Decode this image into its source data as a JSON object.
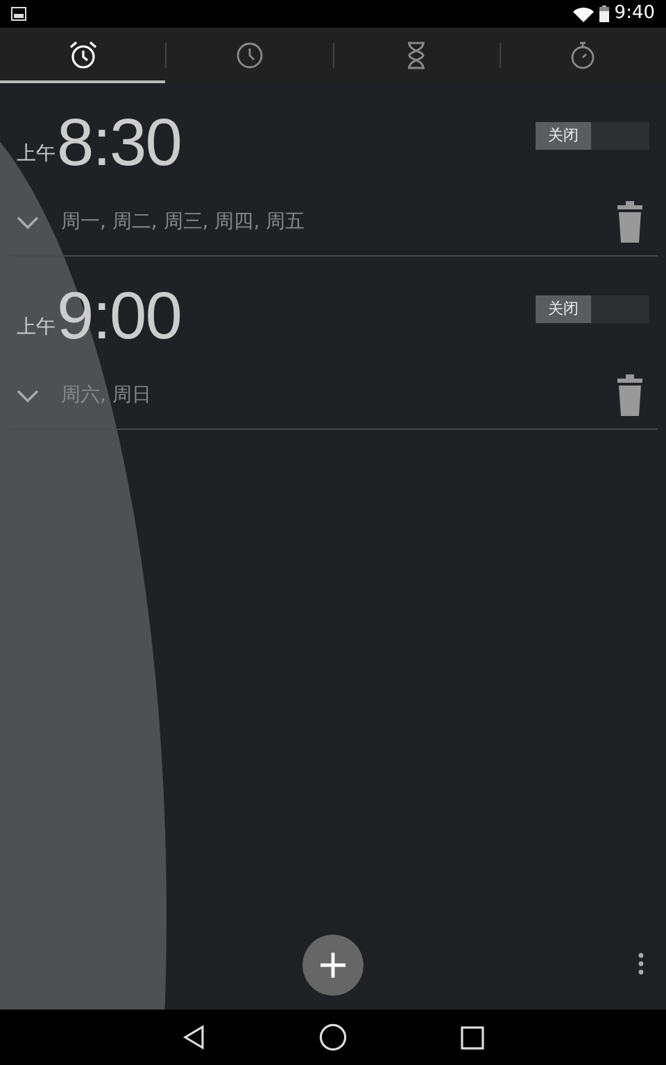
{
  "status_bar": {
    "time": "9:40"
  },
  "tabs": [
    {
      "kind": "alarm",
      "selected": true
    },
    {
      "kind": "clock",
      "selected": false
    },
    {
      "kind": "timer",
      "selected": false
    },
    {
      "kind": "stopwatch",
      "selected": false
    }
  ],
  "alarms": [
    {
      "ampm": "上午",
      "time": "8:30",
      "switch": {
        "label": "关闭",
        "on": false
      },
      "expanded": false,
      "days": "周一, 周二, 周三, 周四, 周五"
    },
    {
      "ampm": "上午",
      "time": "9:00",
      "switch": {
        "label": "关闭",
        "on": false
      },
      "expanded": false,
      "days": "周六, 周日"
    }
  ]
}
